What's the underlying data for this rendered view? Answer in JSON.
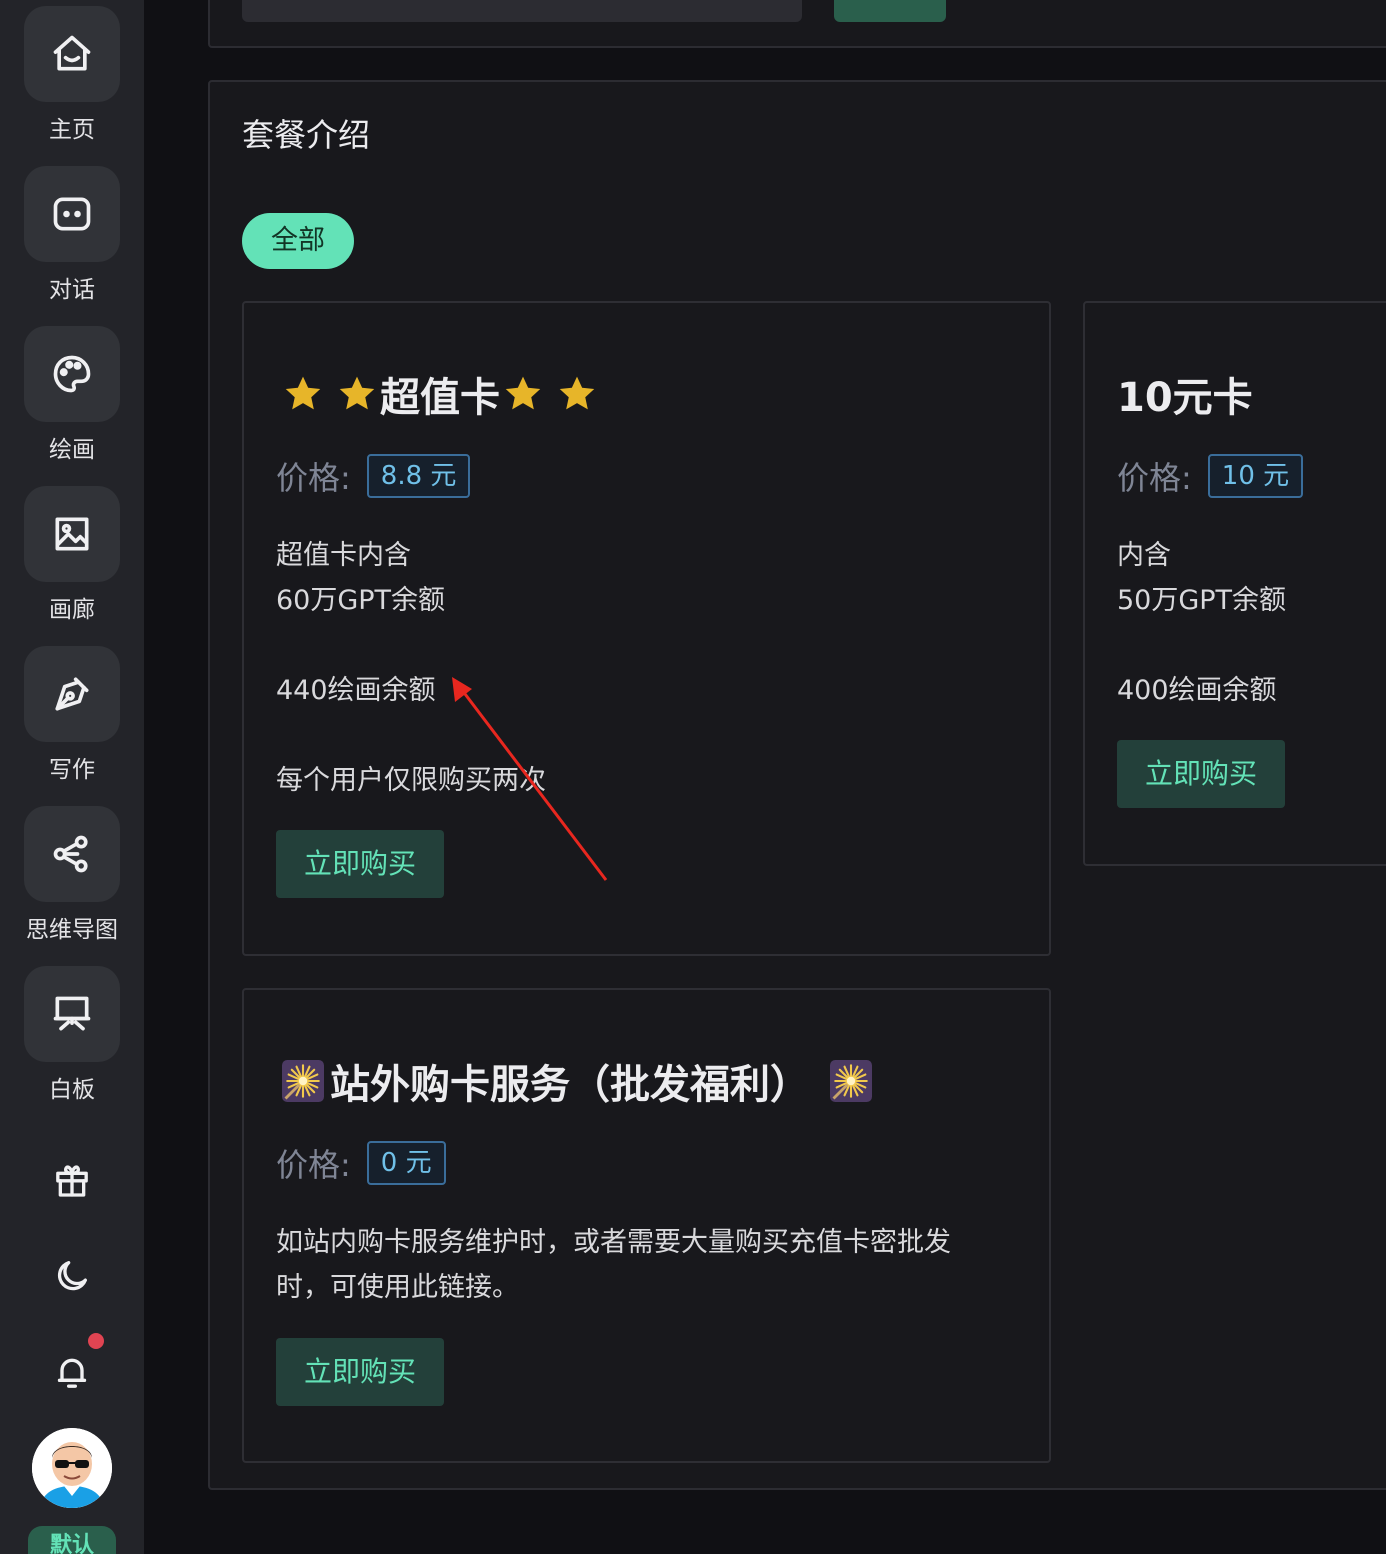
{
  "sidebar": {
    "nav_items": [
      {
        "label": "主页",
        "icon": "home-icon"
      },
      {
        "label": "对话",
        "icon": "chat-icon"
      },
      {
        "label": "绘画",
        "icon": "palette-icon"
      },
      {
        "label": "画廊",
        "icon": "image-icon"
      },
      {
        "label": "写作",
        "icon": "pen-icon"
      },
      {
        "label": "思维导图",
        "icon": "mindmap-icon"
      },
      {
        "label": "白板",
        "icon": "whiteboard-icon"
      }
    ],
    "utility_icons": [
      "gift-icon",
      "moon-icon",
      "bell-icon"
    ],
    "has_notification": true,
    "user_badge": "默认"
  },
  "main": {
    "title": "套餐介绍",
    "filter_tags": [
      {
        "label": "全部",
        "active": true
      }
    ],
    "price_label": "价格:",
    "packages": [
      {
        "title": "超值卡",
        "title_decoration": "star-icon",
        "price": "8.8 元",
        "description": [
          "超值卡内含",
          "60万GPT余额",
          "440绘画余额",
          "每个用户仅限购买两次"
        ],
        "button": "立即购买"
      },
      {
        "title": "10元卡",
        "price": "10 元",
        "description": [
          "内含",
          "50万GPT余额",
          "400绘画余额"
        ],
        "button": "立即购买"
      },
      {
        "title": "站外购卡服务（批发福利）",
        "title_decoration": "sparkler-icon",
        "price": "0 元",
        "description": [
          "如站内购卡服务维护时，或者需要大量购买充值卡密批发",
          "时，可使用此链接。"
        ],
        "button": "立即购买"
      }
    ]
  },
  "colors": {
    "accent": "#63e2b7",
    "price_text": "#70c0e8",
    "star": "#e7b529",
    "arrow": "#e8271f",
    "background": "#18181c",
    "sidebar": "#232429"
  }
}
